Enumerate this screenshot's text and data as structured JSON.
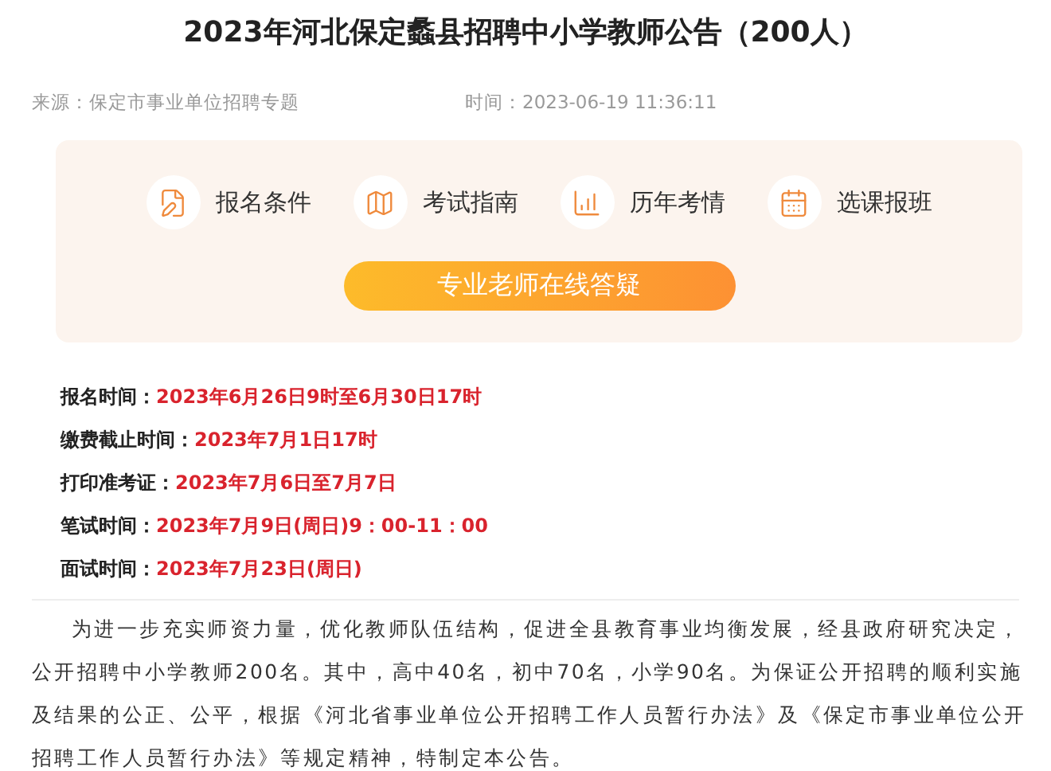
{
  "title": "2023年河北保定蠡县招聘中小学教师公告（200人）",
  "meta": {
    "source_label": "来源：",
    "source": "保定市事业单位招聘专题",
    "time_label": "时间：",
    "time": "2023-06-19 11:36:11"
  },
  "quick_links": [
    {
      "kind": "conditions",
      "label": "报名条件"
    },
    {
      "kind": "guide",
      "label": "考试指南"
    },
    {
      "kind": "history",
      "label": "历年考情"
    },
    {
      "kind": "course",
      "label": "选课报班"
    }
  ],
  "consult_button": "专业老师在线答疑",
  "schedule": [
    {
      "label": "报名时间：",
      "value": "2023年6月26日9时至6月30日17时"
    },
    {
      "label": "缴费截止时间：",
      "value": "2023年7月1日17时"
    },
    {
      "label": "打印准考证：",
      "value": "2023年7月6日至7月7日"
    },
    {
      "label": "笔试时间：",
      "value": "2023年7月9日(周日)9：00-11：00"
    },
    {
      "label": "面试时间：",
      "value": "2023年7月23日(周日)"
    }
  ],
  "paragraph": "为进一步充实师资力量，优化教师队伍结构，促进全县教育事业均衡发展，经县政府研究决定，公开招聘中小学教师200名。其中，高中40名，初中70名，小学90名。为保证公开招聘的顺利实施及结果的公正、公平，根据《河北省事业单位公开招聘工作人员暂行办法》及《保定市事业单位公开招聘工作人员暂行办法》等规定精神，特制定本公告。"
}
